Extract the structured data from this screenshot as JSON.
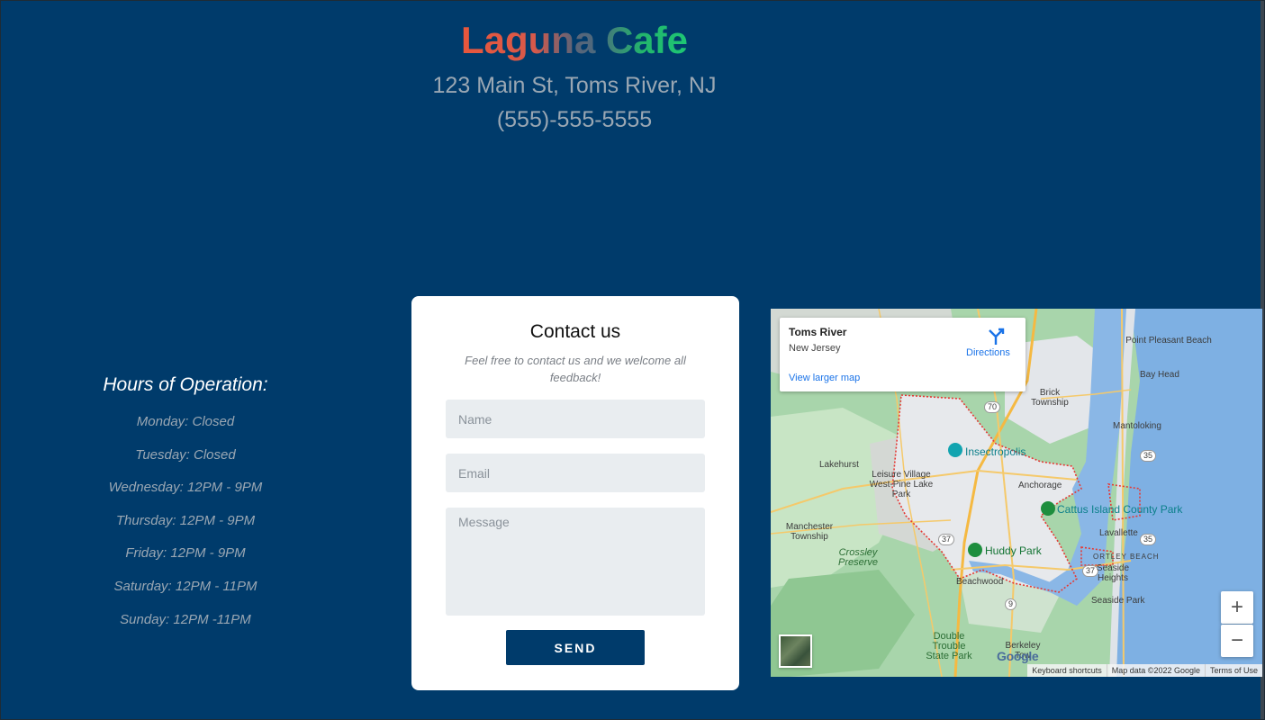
{
  "header": {
    "title": "Laguna Cafe",
    "address": "123 Main St, Toms River, NJ",
    "phone": "(555)-555-5555"
  },
  "hours": {
    "heading": "Hours of Operation:",
    "days": [
      "Monday: Closed",
      "Tuesday: Closed",
      "Wednesday: 12PM - 9PM",
      "Thursday: 12PM - 9PM",
      "Friday: 12PM - 9PM",
      "Saturday: 12PM - 11PM",
      "Sunday: 12PM -11PM"
    ]
  },
  "contact": {
    "heading": "Contact us",
    "subtitle": "Feel free to contact us and we welcome all feedback!",
    "name_placeholder": "Name",
    "email_placeholder": "Email",
    "message_placeholder": "Message",
    "send_label": "SEND"
  },
  "map": {
    "place_name": "Toms River",
    "place_region": "New Jersey",
    "directions_label": "Directions",
    "larger_map_label": "View larger map",
    "zoom_in_label": "+",
    "zoom_out_label": "−",
    "google_logo": "Google",
    "keyboard_shortcuts": "Keyboard shortcuts",
    "map_data": "Map data ©2022 Google",
    "terms": "Terms of Use",
    "labels": {
      "point_pleasant_beach": "Point Pleasant Beach",
      "bay_head": "Bay Head",
      "brick_township": "Brick Township",
      "mantoloking": "Mantoloking",
      "insectropolis": "Insectropolis",
      "lakehurst": "Lakehurst",
      "leisure_village": "Leisure Village West-Pine Lake Park",
      "anchorage": "Anchorage",
      "cattus_island": "Cattus Island County Park",
      "lavallette": "Lavallette",
      "manchester": "Manchester Township",
      "huddy_park": "Huddy Park",
      "crossley": "Crossley Preserve",
      "ortley_beach": "ORTLEY BEACH",
      "seaside_heights": "Seaside Heights",
      "beachwood": "Beachwood",
      "seaside_park": "Seaside Park",
      "double_trouble": "Double Trouble State Park",
      "berkeley": "Berkeley Tow",
      "route_70": "70",
      "route_35a": "35",
      "route_35b": "35",
      "route_37a": "37",
      "route_37b": "37",
      "route_9": "9"
    },
    "colors": {
      "water": "#7eb0e3",
      "land_green": "#9fd0a5",
      "urban": "#e8eaed",
      "boundary": "#e53935",
      "road": "#f5b942"
    }
  }
}
